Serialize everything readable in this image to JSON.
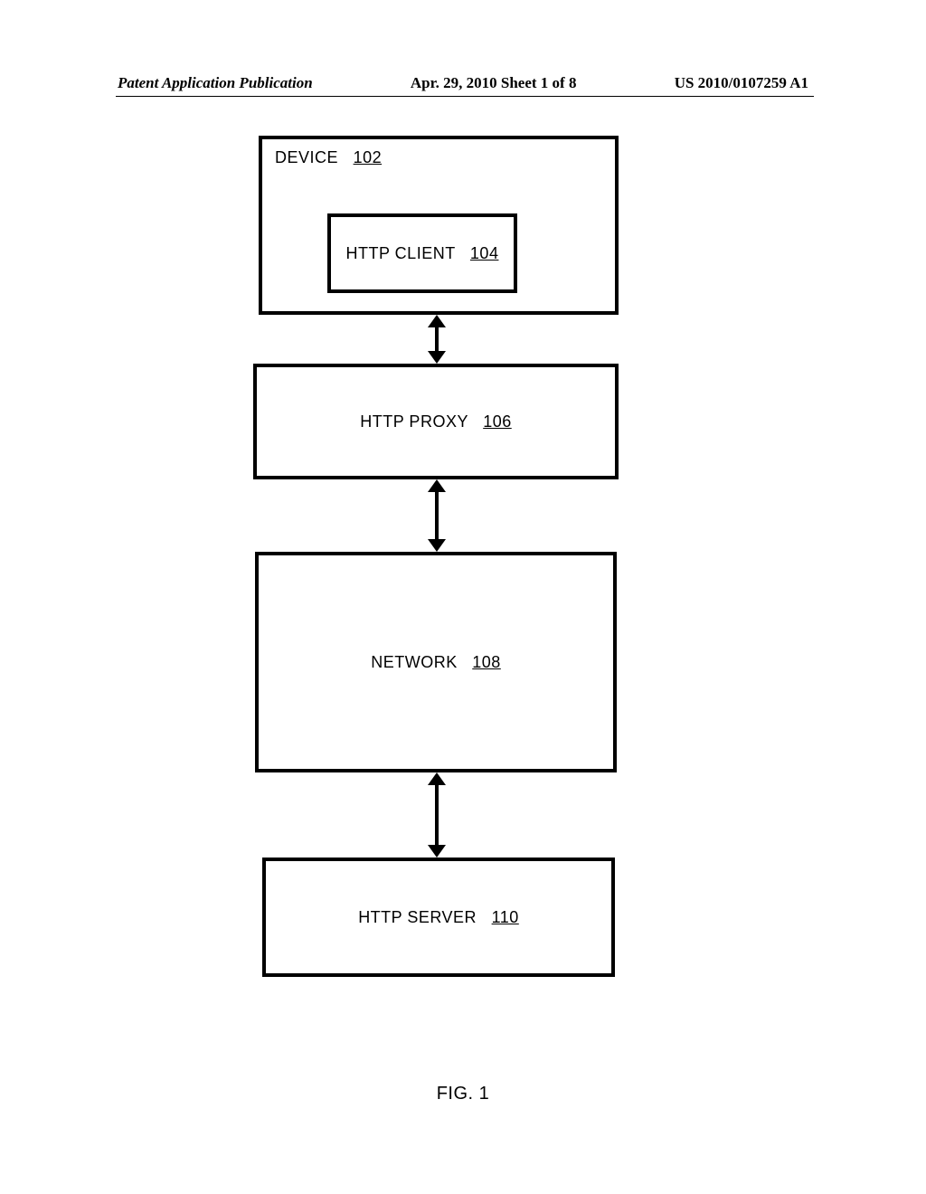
{
  "header": {
    "left": "Patent Application Publication",
    "center": "Apr. 29, 2010  Sheet 1 of 8",
    "right": "US 2010/0107259 A1"
  },
  "diagram": {
    "device": {
      "label": "DEVICE",
      "ref": "102"
    },
    "client": {
      "label": "HTTP CLIENT",
      "ref": "104"
    },
    "proxy": {
      "label": "HTTP PROXY",
      "ref": "106"
    },
    "network": {
      "label": "NETWORK",
      "ref": "108"
    },
    "server": {
      "label": "HTTP SERVER",
      "ref": "110"
    }
  },
  "figure_caption": "FIG. 1"
}
